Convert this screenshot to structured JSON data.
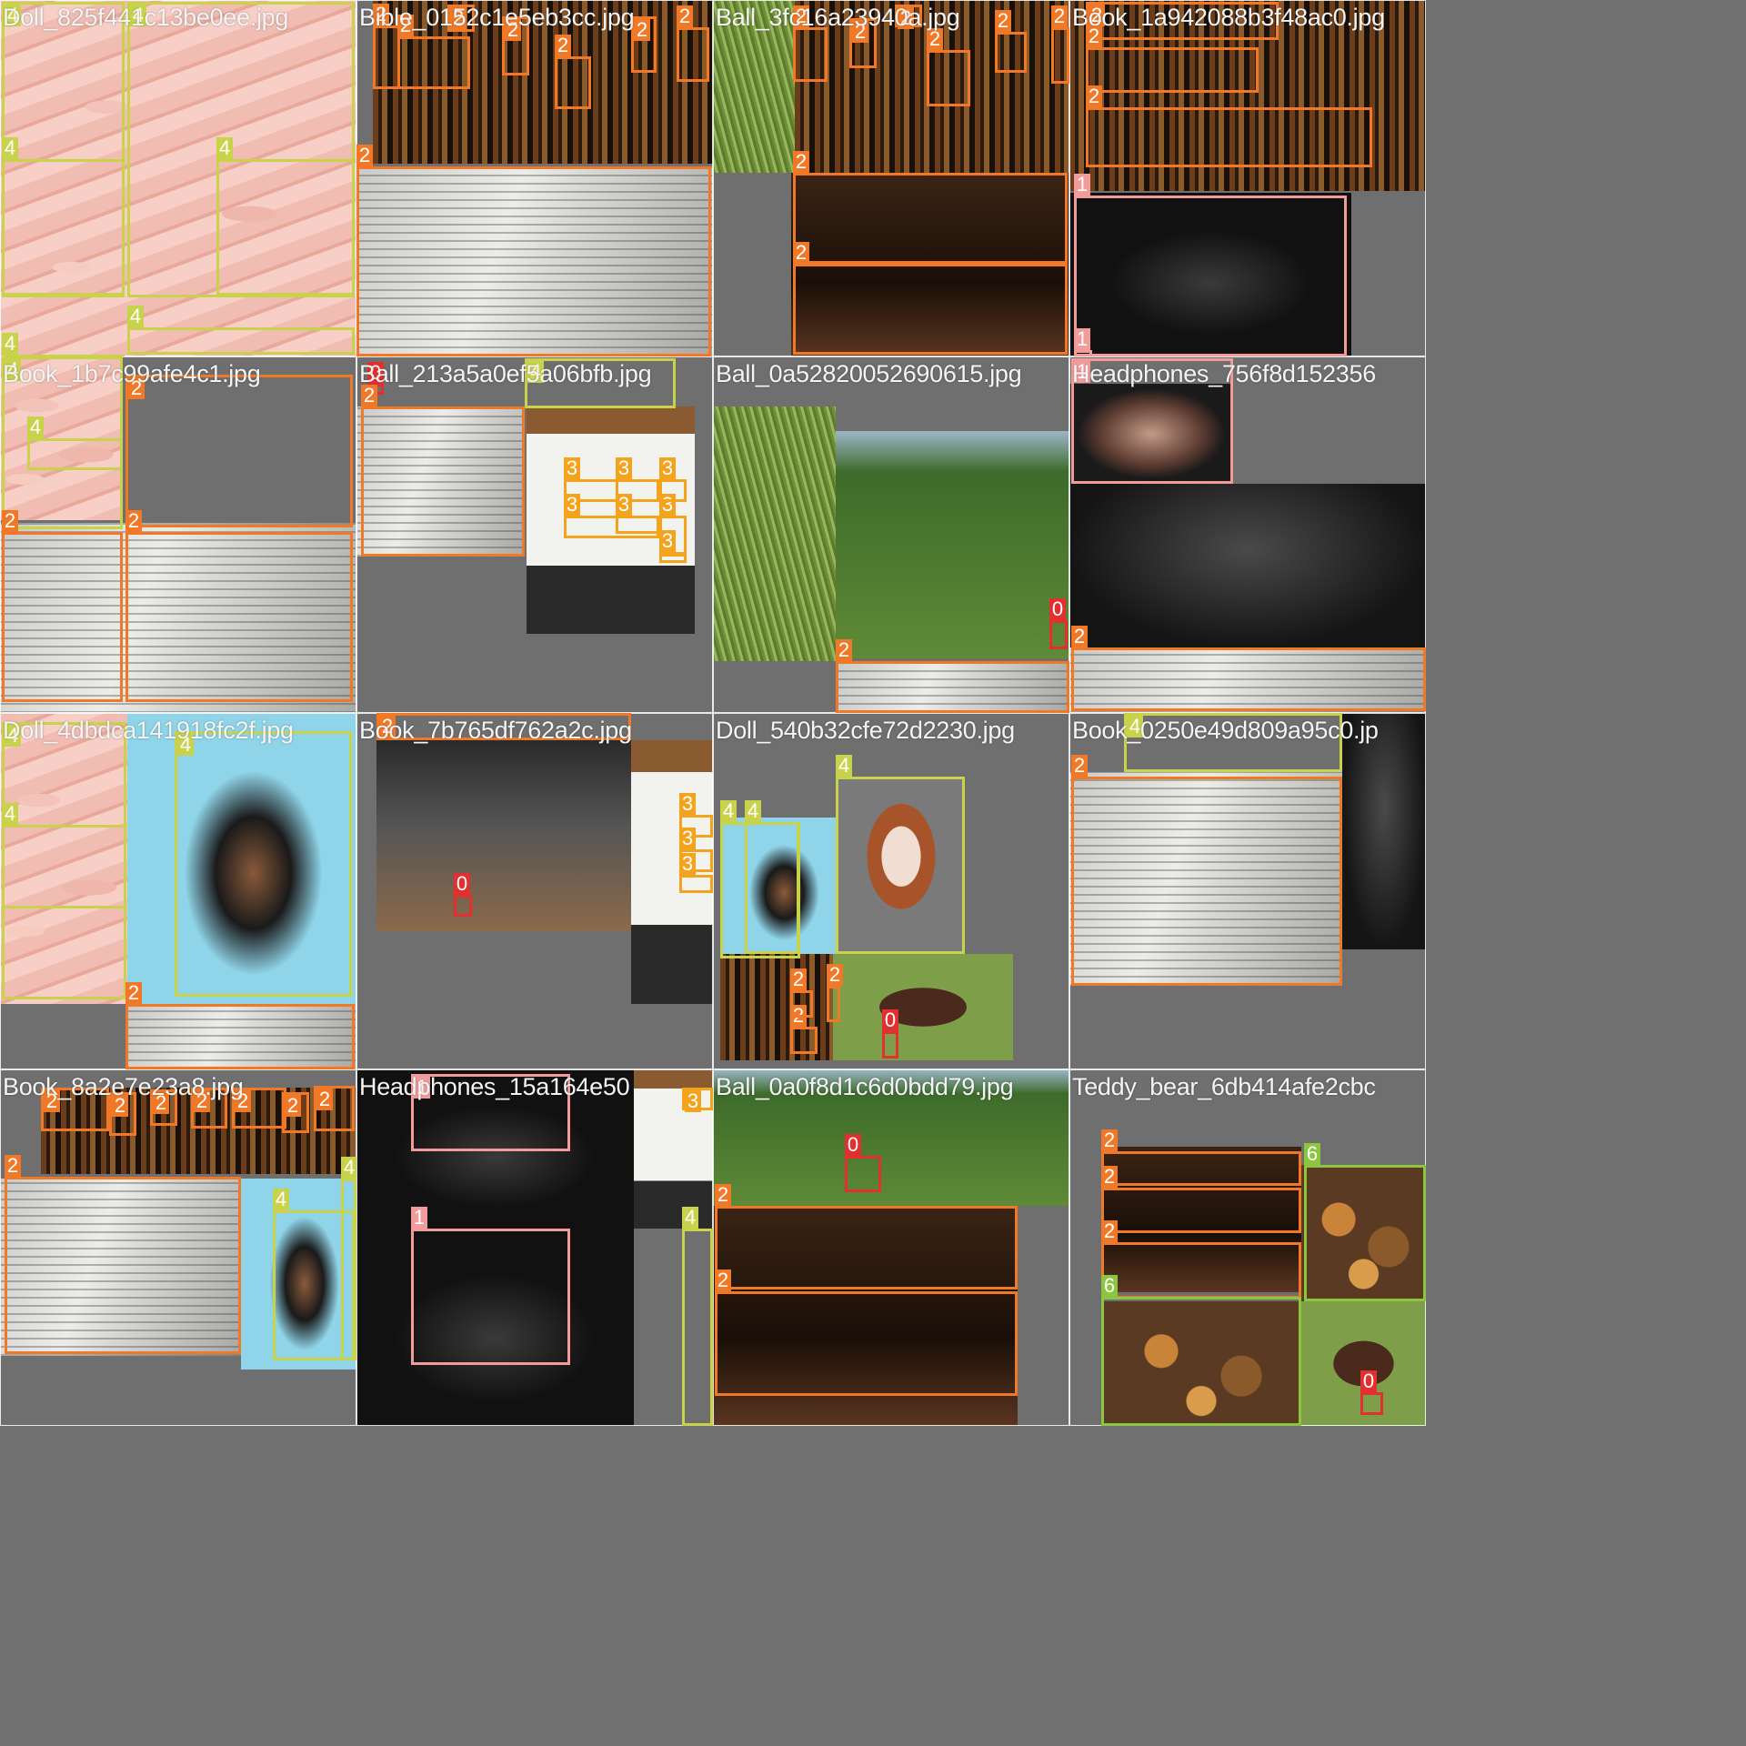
{
  "mosaic": {
    "colors": {
      "0": "#e23030",
      "1": "#f29b9b",
      "2": "#f07826",
      "3": "#f4a31c",
      "4": "#c8d24a",
      "6": "#8cc63e"
    },
    "tiles": [
      {
        "filename": "Doll_825f441c13be0ee.jpg",
        "labels": [
          "4",
          "4",
          "4",
          "4",
          "4",
          "4"
        ]
      },
      {
        "filename": "Bible_0152c1e5eb3cc.jpg",
        "labels": [
          "2",
          "2",
          "2",
          "2",
          "2",
          "2",
          "2",
          "2"
        ]
      },
      {
        "filename": "Ball_3fc16a23940a.jpg",
        "labels": [
          "2",
          "2",
          "2",
          "2",
          "2",
          "2",
          "2",
          "2"
        ]
      },
      {
        "filename": "Book_1a942088b3f48ac0.jpg",
        "labels": [
          "2",
          "2",
          "2",
          "1",
          "1"
        ]
      },
      {
        "filename": "Book_1b7c99afe4c1.jpg",
        "labels": [
          "4",
          "4",
          "2",
          "2",
          "2"
        ]
      },
      {
        "filename": "Ball_213a5a0ef5a06bfb.jpg",
        "labels": [
          "0",
          "2",
          "4",
          "3",
          "3",
          "3",
          "3",
          "3",
          "3",
          "3"
        ]
      },
      {
        "filename": "Ball_0a52820052690615.jpg",
        "labels": [
          "0",
          "2"
        ]
      },
      {
        "filename": "Headphones_756f8d152356",
        "labels": [
          "1",
          "2"
        ]
      },
      {
        "filename": "Doll_4dbdca141918fc2f.jpg",
        "labels": [
          "4",
          "4",
          "4",
          "2"
        ]
      },
      {
        "filename": "Book_7b765df762a2c.jpg",
        "labels": [
          "2",
          "0",
          "3",
          "3",
          "3"
        ]
      },
      {
        "filename": "Doll_540b32cfe72d2230.jpg",
        "labels": [
          "4",
          "4",
          "4",
          "2",
          "2",
          "2",
          "0"
        ]
      },
      {
        "filename": "Book_0250e49d809a95c0.jp",
        "labels": [
          "4",
          "2"
        ]
      },
      {
        "filename": "Book_8a2e7e23a8.jpg",
        "labels": [
          "2",
          "2",
          "2",
          "2",
          "2",
          "2",
          "2",
          "2",
          "4",
          "4"
        ]
      },
      {
        "filename": "Headphones_15a164e50",
        "labels": [
          "1",
          "1",
          "3",
          "4"
        ]
      },
      {
        "filename": "Ball_0a0f8d1c6d0bdd79.jpg",
        "labels": [
          "0",
          "2",
          "2"
        ]
      },
      {
        "filename": "Teddy_bear_6db414afe2cbc",
        "labels": [
          "2",
          "2",
          "2",
          "6",
          "6",
          "0"
        ]
      }
    ]
  }
}
